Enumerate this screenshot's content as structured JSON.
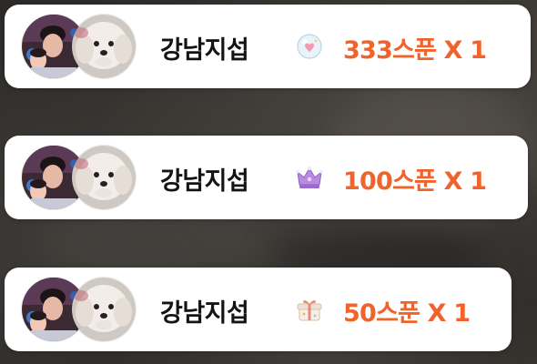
{
  "theme": {
    "amount_color": "#f0642c",
    "nickname_color": "#141414",
    "card_color": "#ffffff"
  },
  "donations": [
    {
      "nickname": "강남지섭",
      "gift_icon": "bubble-heart-icon",
      "amount_text": "333스푼 X 1"
    },
    {
      "nickname": "강남지섭",
      "gift_icon": "crown-icon",
      "amount_text": "100스푼 X 1"
    },
    {
      "nickname": "강남지섭",
      "gift_icon": "gift-box-icon",
      "amount_text": "50스푼 X 1"
    }
  ]
}
